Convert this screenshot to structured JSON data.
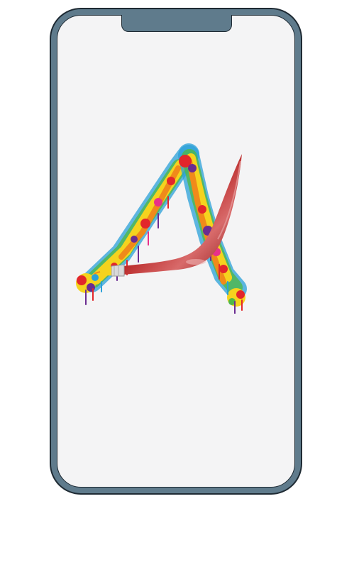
{
  "device": {
    "frame_color": "#5f7b8c",
    "outline_color": "#1e2a33",
    "screen_color": "#f4f4f5"
  },
  "screen": {
    "logo": {
      "icon": "paint-splatter-letter-a-logo-icon",
      "brush_color": "#a71c1c",
      "splatter_colors": [
        "#f5d31e",
        "#f08a1a",
        "#e2262b",
        "#2aa0d8",
        "#4fb848",
        "#6a2c91",
        "#e8308a"
      ]
    }
  }
}
